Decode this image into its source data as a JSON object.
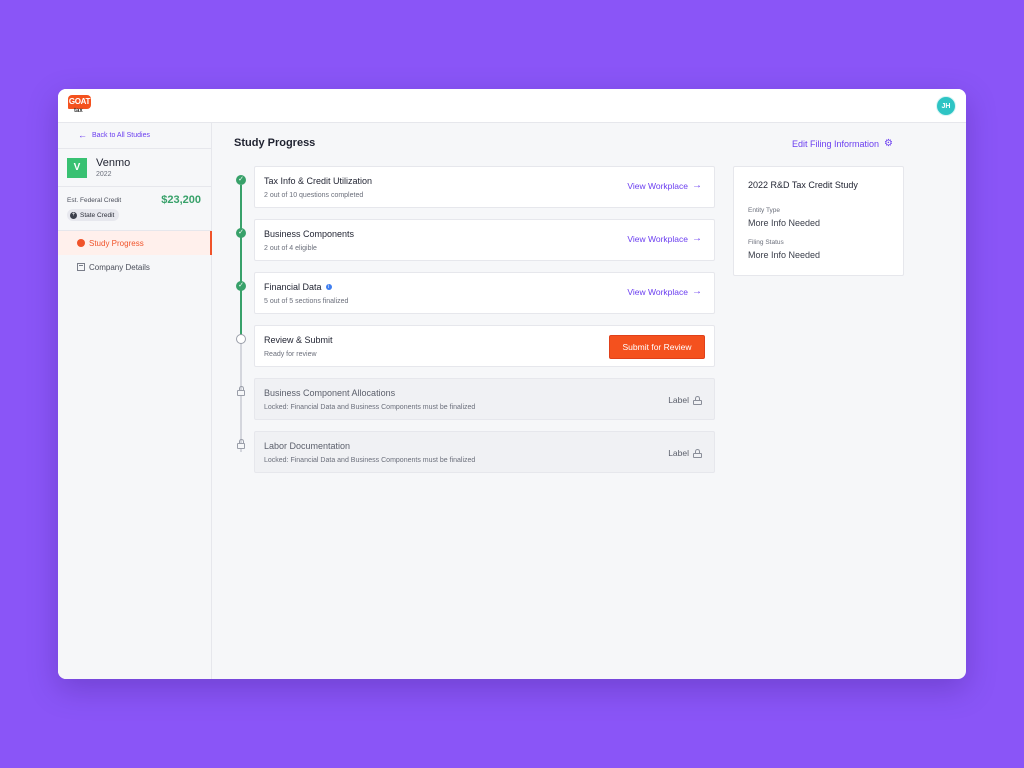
{
  "app": {
    "logo_text": "GOAT",
    "logo_sub": "tax",
    "user_initials": "JH"
  },
  "sidebar": {
    "back_label": "Back to All Studies",
    "company": {
      "initial": "V",
      "name": "Venmo",
      "year": "2022"
    },
    "credit_label": "Est. Federal Credit",
    "credit_value": "$23,200",
    "state_pill": "State Credit",
    "nav": [
      {
        "label": "Study Progress",
        "active": true
      },
      {
        "label": "Company Details",
        "active": false
      }
    ]
  },
  "main": {
    "title": "Study Progress",
    "edit_filing": "Edit Filing Information",
    "steps": [
      {
        "title": "Tax Info & Credit Utilization",
        "subtitle": "2 out of 10 questions completed",
        "status": "complete",
        "action": "View Workplace"
      },
      {
        "title": "Business Components",
        "subtitle": "2 out of 4 eligible",
        "status": "complete",
        "action": "View Workplace"
      },
      {
        "title": "Financial Data",
        "subtitle": "5 out of 5 sections finalized",
        "status": "complete",
        "action": "View Workplace"
      },
      {
        "title": "Review & Submit",
        "subtitle": "Ready for review",
        "status": "open",
        "action": "Submit for Review"
      },
      {
        "title": "Business Component Allocations",
        "subtitle": "Locked: Financial Data and Business Components must be finalized",
        "status": "locked",
        "action": "Label"
      },
      {
        "title": "Labor Documentation",
        "subtitle": "Locked: Financial Data and Business Components must be finalized",
        "status": "locked",
        "action": "Label"
      }
    ]
  },
  "study_card": {
    "title": "2022 R&D Tax Credit Study",
    "entity_type_label": "Entity Type",
    "entity_type_value": "More Info Needed",
    "filing_status_label": "Filing Status",
    "filing_status_value": "More Info Needed"
  },
  "colors": {
    "background": "#8a55f7",
    "accent": "#6b3ef0",
    "brand": "#f4511e",
    "success": "#38a16a"
  }
}
